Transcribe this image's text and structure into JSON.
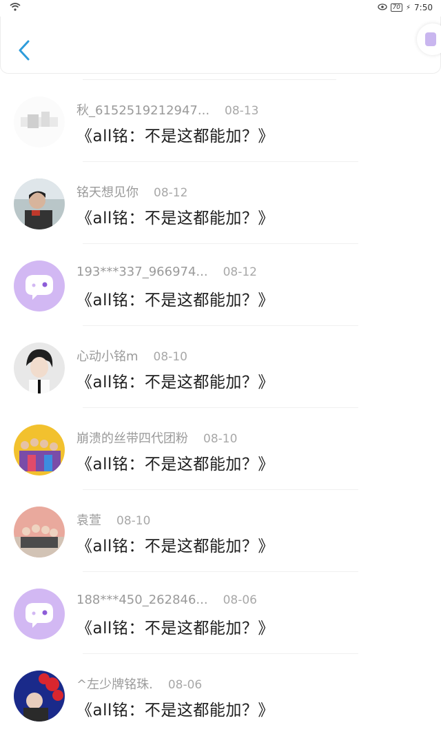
{
  "status": {
    "battery": "70",
    "time": "7:50"
  },
  "colors": {
    "accent": "#2d9cdb",
    "default_avatar": "#d2b8f3"
  },
  "messages": [
    {
      "name": "秋_6152519212947...",
      "date": "08-13",
      "text": "《all铭：不是这都能加？》",
      "avatar": "photo"
    },
    {
      "name": "铭天想见你",
      "date": "08-12",
      "text": "《all铭：不是这都能加？》",
      "avatar": "photo"
    },
    {
      "name": "193***337_966974...",
      "date": "08-12",
      "text": "《all铭：不是这都能加？》",
      "avatar": "default-chat-icon"
    },
    {
      "name": "心动小铭m",
      "date": "08-10",
      "text": "《all铭：不是这都能加？》",
      "avatar": "photo"
    },
    {
      "name": "崩溃的丝带四代团粉",
      "date": "08-10",
      "text": "《all铭：不是这都能加？》",
      "avatar": "photo"
    },
    {
      "name": "袁萱",
      "date": "08-10",
      "text": "《all铭：不是这都能加？》",
      "avatar": "photo"
    },
    {
      "name": "188***450_262846...",
      "date": "08-06",
      "text": "《all铭：不是这都能加？》",
      "avatar": "default-chat-icon"
    },
    {
      "name": "^左少牌铭珠.",
      "date": "08-06",
      "text": "《all铭：不是这都能加？》",
      "avatar": "photo"
    }
  ]
}
